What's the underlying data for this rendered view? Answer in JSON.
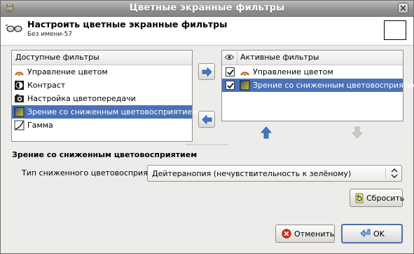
{
  "window": {
    "title": "Цветные экранные фильтры",
    "icon": "gimp-icon",
    "close_icon": "close-icon"
  },
  "header": {
    "title": "Настроить цветные экранные фильтры",
    "subtitle": "Без имени-57",
    "icon": "glasses-icon"
  },
  "available": {
    "heading": "Доступные фильтры",
    "items": [
      {
        "label": "Управление цветом",
        "icon": "color-management-icon",
        "selected": false
      },
      {
        "label": "Контраст",
        "icon": "contrast-icon",
        "selected": false
      },
      {
        "label": "Настройка цветопередачи",
        "icon": "color-proof-icon",
        "selected": false
      },
      {
        "label": "Зрение со сниженным цветовосприятием",
        "icon": "color-deficient-icon",
        "selected": true
      },
      {
        "label": "Гамма",
        "icon": "gamma-icon",
        "selected": false
      }
    ]
  },
  "active": {
    "heading": "Активные фильтры",
    "heading_icon": "eye-icon",
    "items": [
      {
        "label": "Управление цветом",
        "icon": "color-management-icon",
        "checked": true,
        "selected": false
      },
      {
        "label": "Зрение со сниженным цветовосприятием",
        "icon": "color-deficient-icon",
        "checked": true,
        "selected": true
      }
    ]
  },
  "section": {
    "title": "Зрение со сниженным цветовосприятием",
    "field_label": "Тип сниженного цветовосприятия:",
    "field_value": "Дейтеранопия (нечувствительность к зелёному)"
  },
  "buttons": {
    "reset": "Сбросить",
    "cancel": "Отменить",
    "ok": "OK"
  },
  "colors": {
    "selection": "#4b72b7",
    "arrow_blue": "#3f79c9",
    "title_bar": "#8e8e8e"
  }
}
